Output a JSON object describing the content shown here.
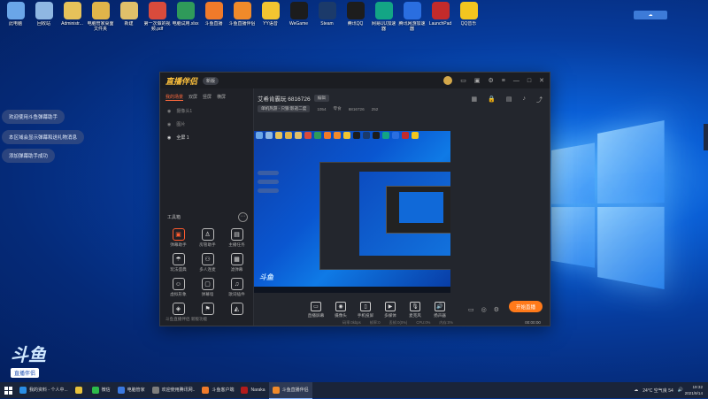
{
  "desktop": {
    "icons": [
      {
        "label": "此电脑",
        "color": "#6aa6e8"
      },
      {
        "label": "回收站",
        "color": "#8fb7e2"
      },
      {
        "label": "Administr...",
        "color": "#e6c25a"
      },
      {
        "label": "电脑管家桌面文件夹",
        "color": "#e0b54a"
      },
      {
        "label": "新建",
        "color": "#e0c06a"
      },
      {
        "label": "第一次做的视频.pdf",
        "color": "#d94b3c"
      },
      {
        "label": "电脑试用.xlsx",
        "color": "#2f9a5a"
      },
      {
        "label": "斗鱼直播",
        "color": "#f07a2a"
      },
      {
        "label": "斗鱼直播伴侣",
        "color": "#f08a2a"
      },
      {
        "label": "YY语音",
        "color": "#f2c531"
      },
      {
        "label": "WeGame",
        "color": "#1c1c1c"
      },
      {
        "label": "Steam",
        "color": "#1b3a6a"
      },
      {
        "label": "腾讯QQ",
        "color": "#1d1d1d"
      },
      {
        "label": "网易UU加速器",
        "color": "#13a585"
      },
      {
        "label": "腾讯网游加速器",
        "color": "#2a6ee0"
      },
      {
        "label": "LaunchPad",
        "color": "#c32b2b"
      },
      {
        "label": "QQ音乐",
        "color": "#f3c61f"
      }
    ],
    "tray_badge": "",
    "bubbles": [
      "欢迎使用斗鱼弹幕助手",
      "本区域会显示弹幕和送礼物消息",
      "添加弹幕助手成功"
    ],
    "logo": {
      "brand": "斗鱼",
      "tag": "直播伴侣",
      "room": "6816726"
    }
  },
  "app": {
    "brand": "直播伴侣",
    "version": "新版",
    "sidebar_tabs": [
      "我的场景",
      "双屏",
      "竖屏",
      "横屏"
    ],
    "sources": [
      {
        "label": "摄像头1",
        "on": false
      },
      {
        "label": "图片",
        "on": false
      },
      {
        "label": "全屏 1",
        "on": true
      }
    ],
    "tools_title": "工具箱",
    "tools": [
      {
        "label": "弹幕助手",
        "icon": "▣",
        "hot": true
      },
      {
        "label": "房管助手",
        "icon": "♙",
        "hot": false
      },
      {
        "label": "主播任务",
        "icon": "▤",
        "hot": false
      },
      {
        "label": "玩法盛典",
        "icon": "☂",
        "hot": false
      },
      {
        "label": "多人连麦",
        "icon": "⚇",
        "hot": false
      },
      {
        "label": "滤弹幕",
        "icon": "▦",
        "hot": false
      },
      {
        "label": "虚拟形象",
        "icon": "☺",
        "hot": false
      },
      {
        "label": "弹幕墙",
        "icon": "▢",
        "hot": false
      },
      {
        "label": "歌词插件",
        "icon": "♫",
        "hot": false
      },
      {
        "label": "",
        "icon": "◈",
        "hot": false
      },
      {
        "label": "",
        "icon": "⚑",
        "hot": false
      },
      {
        "label": "",
        "icon": "◭",
        "hot": false
      }
    ],
    "footer_note": "斗鱼直播伴侣 新版功能",
    "room_title": "艾希肯霸玩 6816726",
    "edit_label": "编辑",
    "room_category": "单机热游 - 只狼:影逝二度",
    "room_stats": [
      "1054",
      "零食",
      "6816726",
      "252"
    ],
    "controls": [
      {
        "label": "直播屏幕",
        "icon": "▭"
      },
      {
        "label": "摄像头",
        "icon": "◉"
      },
      {
        "label": "手机投屏",
        "icon": "▯"
      },
      {
        "label": "多媒体",
        "icon": "▶"
      },
      {
        "label": "麦克风",
        "icon": "🎙"
      },
      {
        "label": "扬声器",
        "icon": "🔊"
      }
    ],
    "start_live": "开始直播",
    "status": [
      "码率:0kbps",
      "帧率:0",
      "丢帧:0(0%)",
      "CPU:0%",
      "内存:0%"
    ],
    "timer": "00:00:00"
  },
  "taskbar": {
    "items": [
      {
        "label": "我的资料 - 个人中...",
        "color": "#2a8ee6",
        "active": false
      },
      {
        "label": "",
        "color": "#e8c23a",
        "active": false
      },
      {
        "label": "微信",
        "color": "#2dbb4a",
        "active": false
      },
      {
        "label": "电脑管家",
        "color": "#3a78e0",
        "active": false
      },
      {
        "label": "欢迎使用腾讯网..",
        "color": "#7d7d7d",
        "active": false
      },
      {
        "label": "斗鱼客户端",
        "color": "#f07a2a",
        "active": false
      },
      {
        "label": "Naraka",
        "color": "#b31c1c",
        "active": false
      },
      {
        "label": "斗鱼直播伴侣",
        "color": "#f08a2a",
        "active": true
      }
    ],
    "weather": "24°C 空气良 54",
    "time": "19:32",
    "date": "2021/9/14"
  }
}
